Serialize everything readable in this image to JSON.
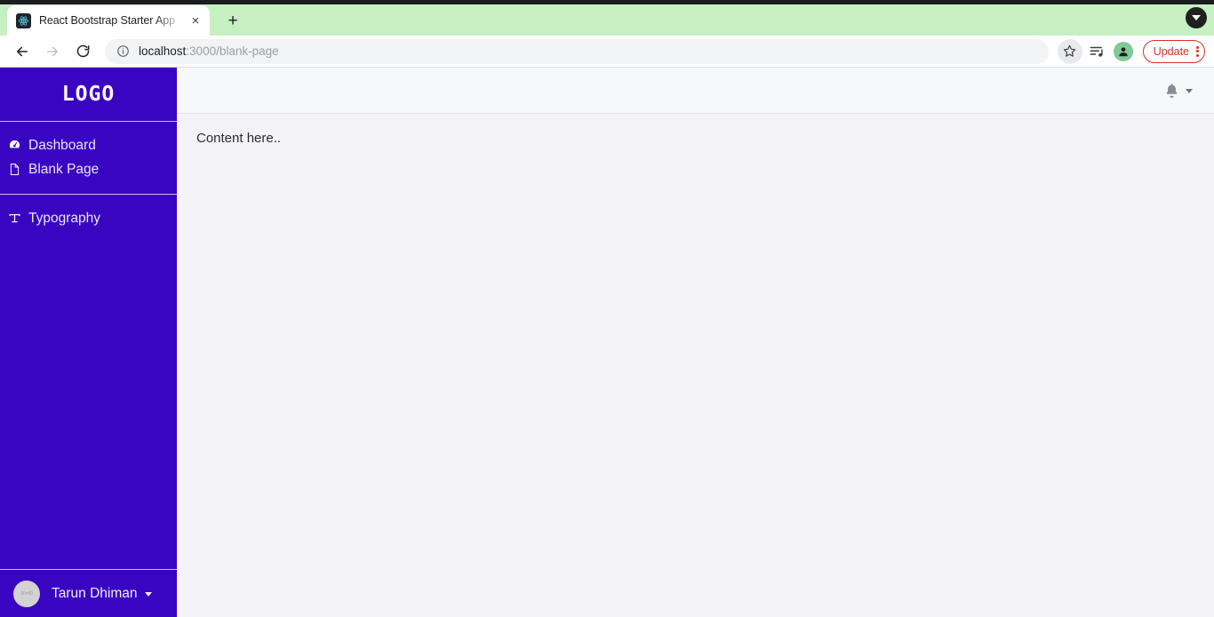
{
  "browser": {
    "tab": {
      "title": "React Bootstrap Starter App",
      "favicon_name": "react-logo-icon",
      "close_label": "×"
    },
    "new_tab_label": "+",
    "nav": {
      "back_label": "←",
      "forward_label": "→",
      "reload_label": "⟳"
    },
    "omnibox": {
      "host": "localhost",
      "path": ":3000/blank-page",
      "site_info_icon": "info-circle-icon"
    },
    "actions": {
      "bookmark_icon": "star-icon",
      "reading_list_icon": "reading-list-icon",
      "profile_icon": "person-icon",
      "update_label": "Update",
      "menu_icon": "three-dots-vertical-icon",
      "tab_search_icon": "chevron-down-circle-icon"
    }
  },
  "sidebar": {
    "brand": "LOGO",
    "groups": [
      {
        "items": [
          {
            "label": "Dashboard",
            "icon": "speedometer-icon"
          },
          {
            "label": "Blank Page",
            "icon": "file-earmark-icon"
          }
        ]
      },
      {
        "items": [
          {
            "label": "Typography",
            "icon": "type-icon"
          }
        ]
      }
    ],
    "user": {
      "name": "Tarun Dhiman",
      "avatar_placeholder": "50×50",
      "caret_icon": "caret-down-icon"
    }
  },
  "topbar": {
    "notifications": {
      "icon": "bell-icon",
      "caret_icon": "caret-down-icon"
    }
  },
  "main": {
    "content_text": "Content here.."
  },
  "colors": {
    "sidebar_bg": "#3a05c0",
    "tabstrip_bg": "#c6efc2",
    "content_bg": "#f3f3f8",
    "topbar_bg": "#f7f8fa",
    "update_accent": "#d93025"
  }
}
